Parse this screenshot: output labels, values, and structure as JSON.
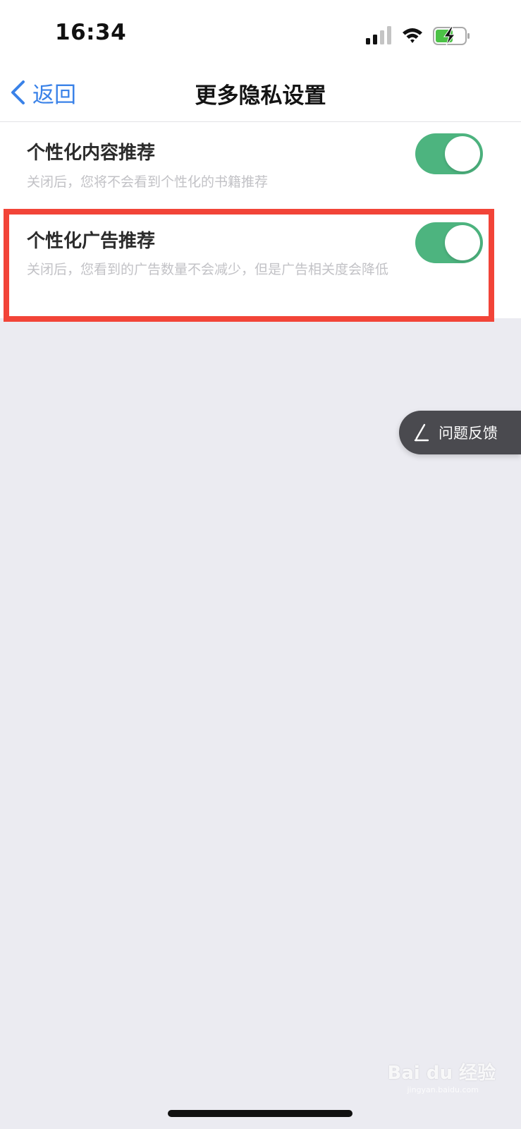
{
  "status_bar": {
    "time": "16:34"
  },
  "nav": {
    "back_label": "返回",
    "title": "更多隐私设置"
  },
  "settings": [
    {
      "title": "个性化内容推荐",
      "description": "关闭后，您将不会看到个性化的书籍推荐",
      "enabled": true
    },
    {
      "title": "个性化广告推荐",
      "description": "关闭后，您看到的广告数量不会减少，但是广告相关度会降低",
      "enabled": true
    }
  ],
  "feedback": {
    "label": "问题反馈"
  },
  "watermark": {
    "text": "Bai du 经验",
    "sub": "jingyan.baidu.com"
  },
  "colors": {
    "toggle_on": "#4db47f",
    "accent": "#3a82e8",
    "highlight": "#f24438",
    "background": "#ebebf1"
  },
  "icons": {
    "back": "chevron-left-icon",
    "signal": "cellular-signal-icon",
    "wifi": "wifi-icon",
    "battery": "battery-charging-icon",
    "feedback": "pencil-icon"
  }
}
